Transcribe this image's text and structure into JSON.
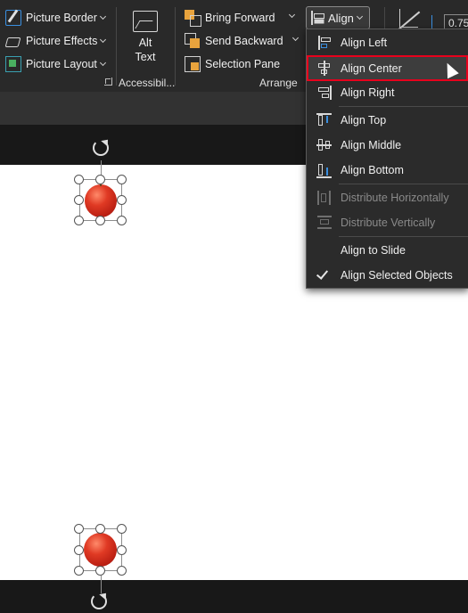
{
  "ribbon": {
    "picture_border": "Picture Border",
    "picture_effects": "Picture Effects",
    "picture_layout": "Picture Layout",
    "alt_text_line1": "Alt",
    "alt_text_line2": "Text",
    "accessibility_group": "Accessibil...",
    "bring_forward": "Bring Forward",
    "send_backward": "Send Backward",
    "selection_pane": "Selection Pane",
    "arrange_group": "Arrange",
    "align_button": "Align",
    "height_value": "0.75"
  },
  "align_menu": {
    "items": [
      {
        "label": "Align Left",
        "icon": "align-left-icon",
        "enabled": true
      },
      {
        "label": "Align Center",
        "icon": "align-center-icon",
        "enabled": true,
        "highlighted": true
      },
      {
        "label": "Align Right",
        "icon": "align-right-icon",
        "enabled": true
      },
      {
        "label": "Align Top",
        "icon": "align-top-icon",
        "enabled": true
      },
      {
        "label": "Align Middle",
        "icon": "align-middle-icon",
        "enabled": true
      },
      {
        "label": "Align Bottom",
        "icon": "align-bottom-icon",
        "enabled": true
      },
      {
        "label": "Distribute Horizontally",
        "icon": "distribute-horizontally-icon",
        "enabled": false
      },
      {
        "label": "Distribute Vertically",
        "icon": "distribute-vertically-icon",
        "enabled": false
      },
      {
        "label": "Align to Slide",
        "icon": "",
        "enabled": true
      },
      {
        "label": "Align Selected Objects",
        "icon": "check-icon",
        "enabled": true,
        "checked": true
      }
    ]
  },
  "colors": {
    "ribbon_bg": "#292929",
    "menu_bg": "#2b2b2b",
    "highlight_border": "#e8001c",
    "accent_blue": "#3a8fe0",
    "accent_orange": "#e8a33d",
    "slide_bg": "#ffffff"
  }
}
